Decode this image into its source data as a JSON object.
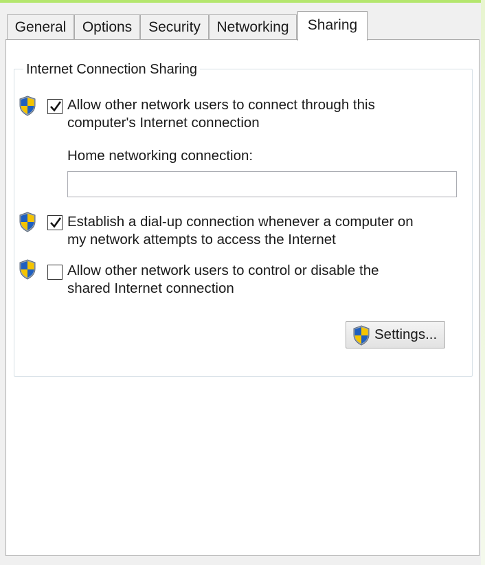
{
  "tabs": [
    {
      "label": "General",
      "active": false
    },
    {
      "label": "Options",
      "active": false
    },
    {
      "label": "Security",
      "active": false
    },
    {
      "label": "Networking",
      "active": false
    },
    {
      "label": "Sharing",
      "active": true
    }
  ],
  "group": {
    "title": "Internet Connection Sharing",
    "options": [
      {
        "line1": "Allow other network users to connect through this",
        "line2": "computer's Internet connection",
        "checked": true,
        "icon": "uac-shield-icon"
      },
      {
        "line1": "Establish a dial-up connection whenever a computer on",
        "line2": "my network attempts to access the Internet",
        "checked": true,
        "icon": "uac-shield-icon"
      },
      {
        "line1": "Allow other network users to control or disable the",
        "line2": "shared Internet connection",
        "checked": false,
        "icon": "uac-shield-icon"
      }
    ],
    "home_connection_label": "Home networking connection:",
    "home_connection_value": "",
    "settings_button": "Settings..."
  },
  "colors": {
    "shield_blue": "#1f5fbf",
    "shield_yellow": "#f5c400",
    "window_bg": "#f0f0f0",
    "accent_edge": "#b4e66e"
  }
}
